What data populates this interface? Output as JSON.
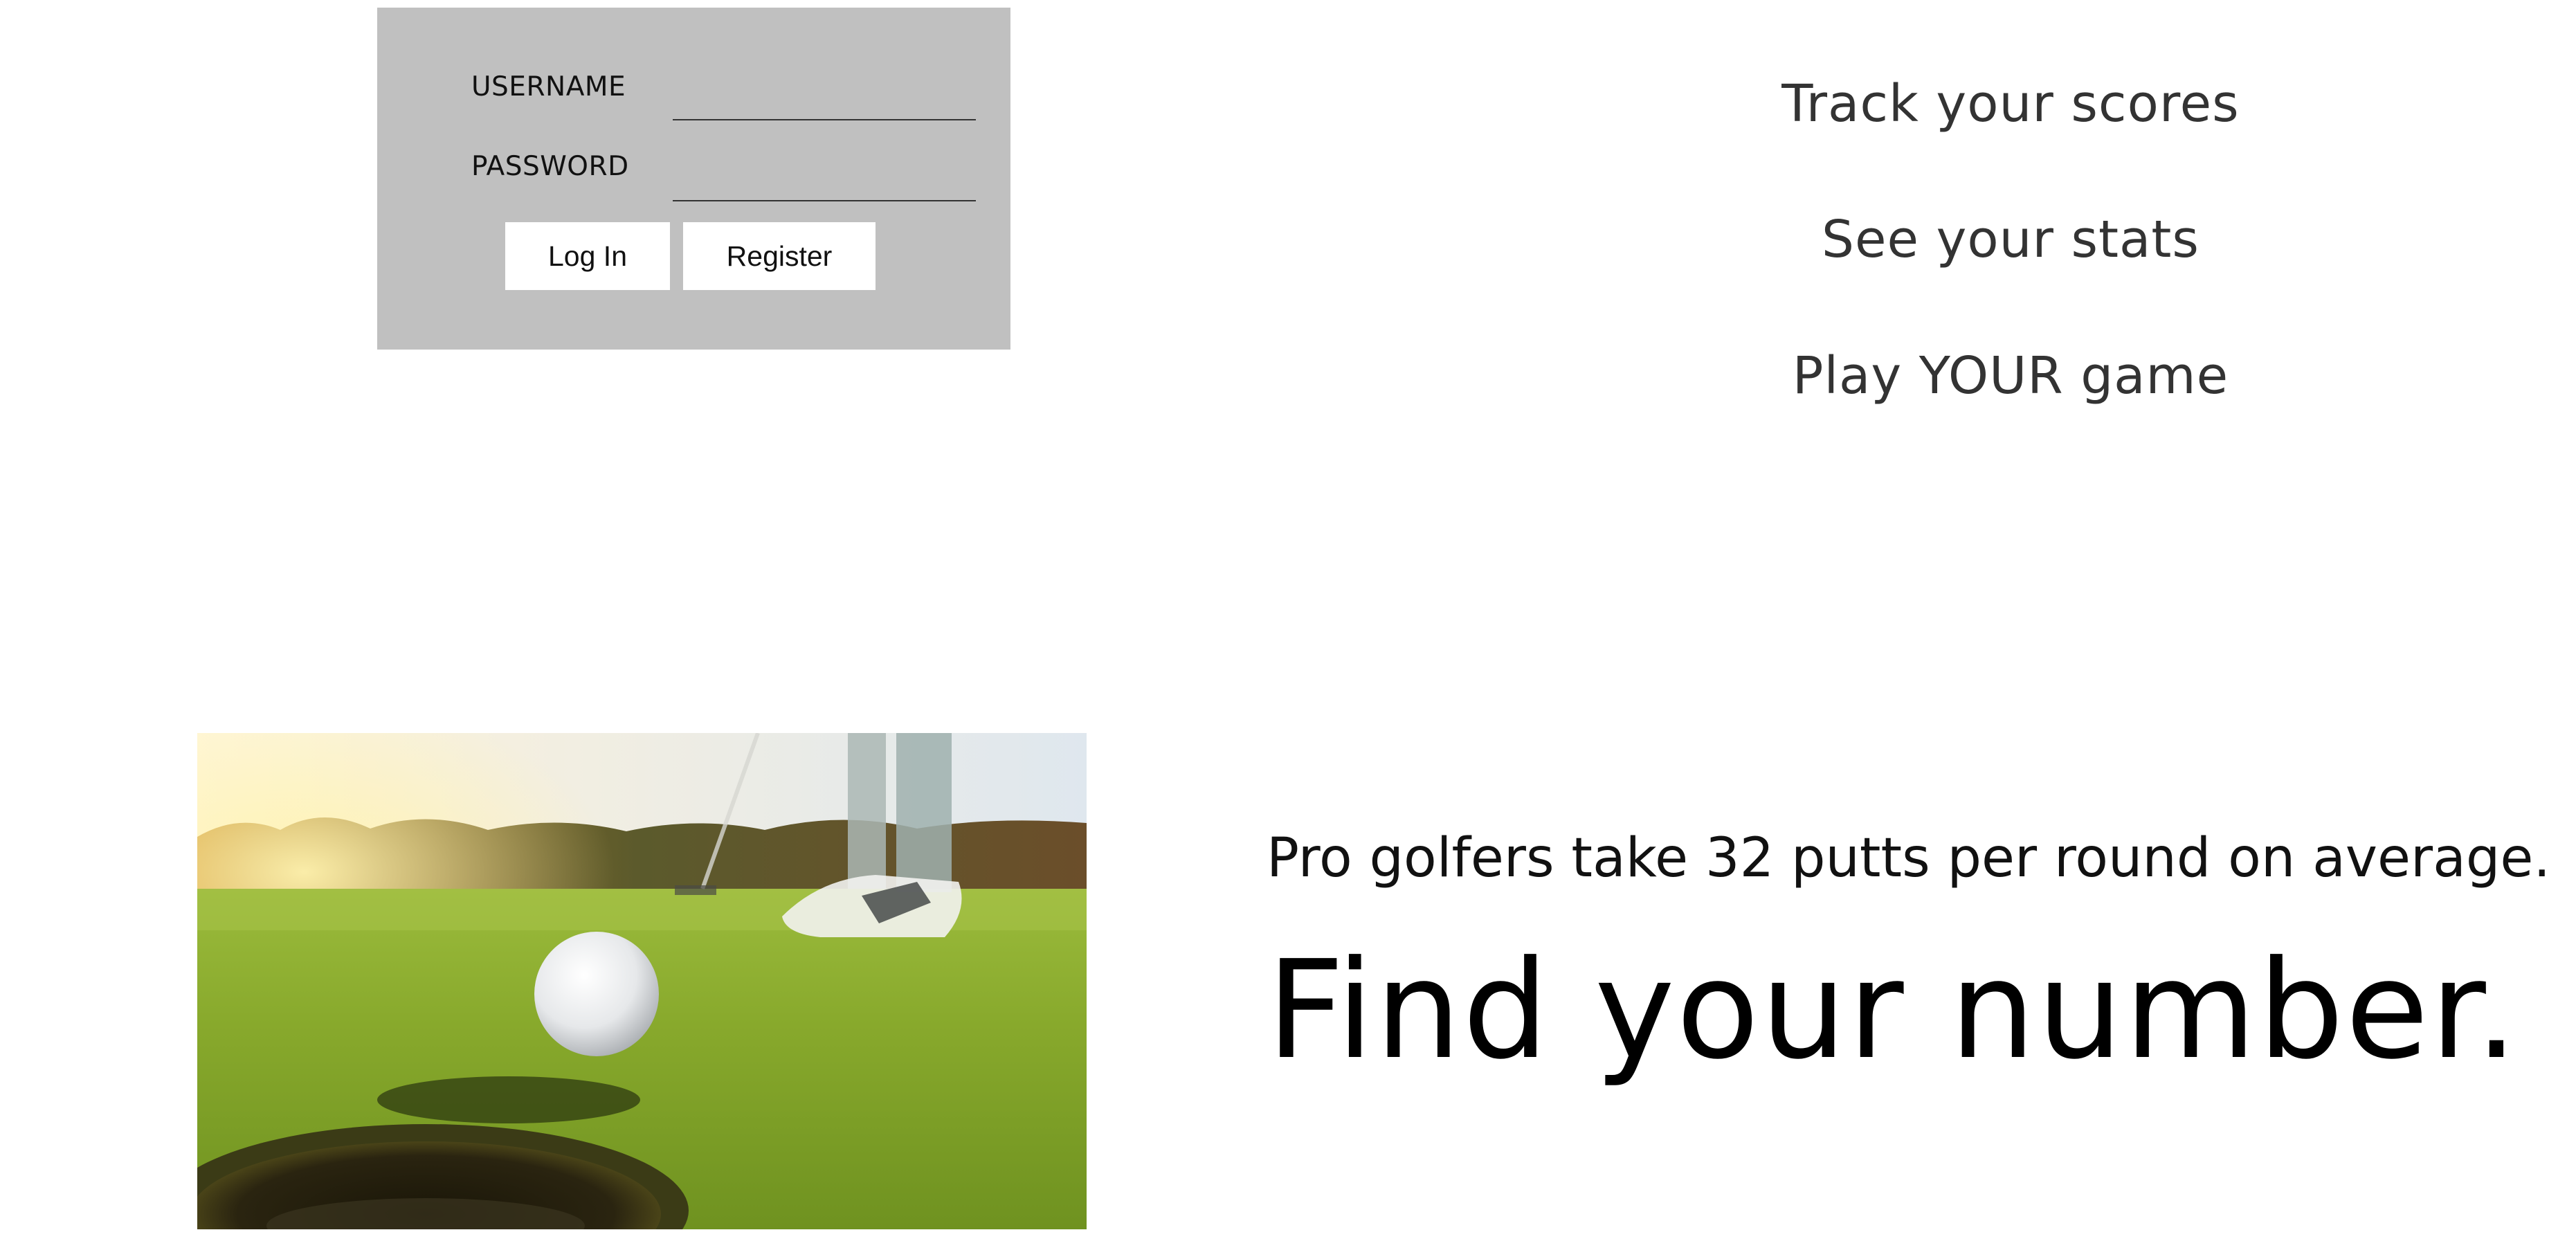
{
  "login": {
    "username_label": "USERNAME",
    "username_value": "",
    "password_label": "PASSWORD",
    "password_value": "",
    "login_button": "Log In",
    "register_button": "Register"
  },
  "taglines": {
    "track": "Track your scores",
    "stats": "See your stats",
    "play": "Play YOUR game"
  },
  "hero": {
    "image_icon": "golf-ball-near-hole-photo",
    "fact": "Pro golfers take 32 putts per round on average.",
    "cta": "Find your number."
  },
  "colors": {
    "panel_background": "#c0c0c0",
    "button_background": "#ffffff",
    "page_background": "#ffffff"
  }
}
